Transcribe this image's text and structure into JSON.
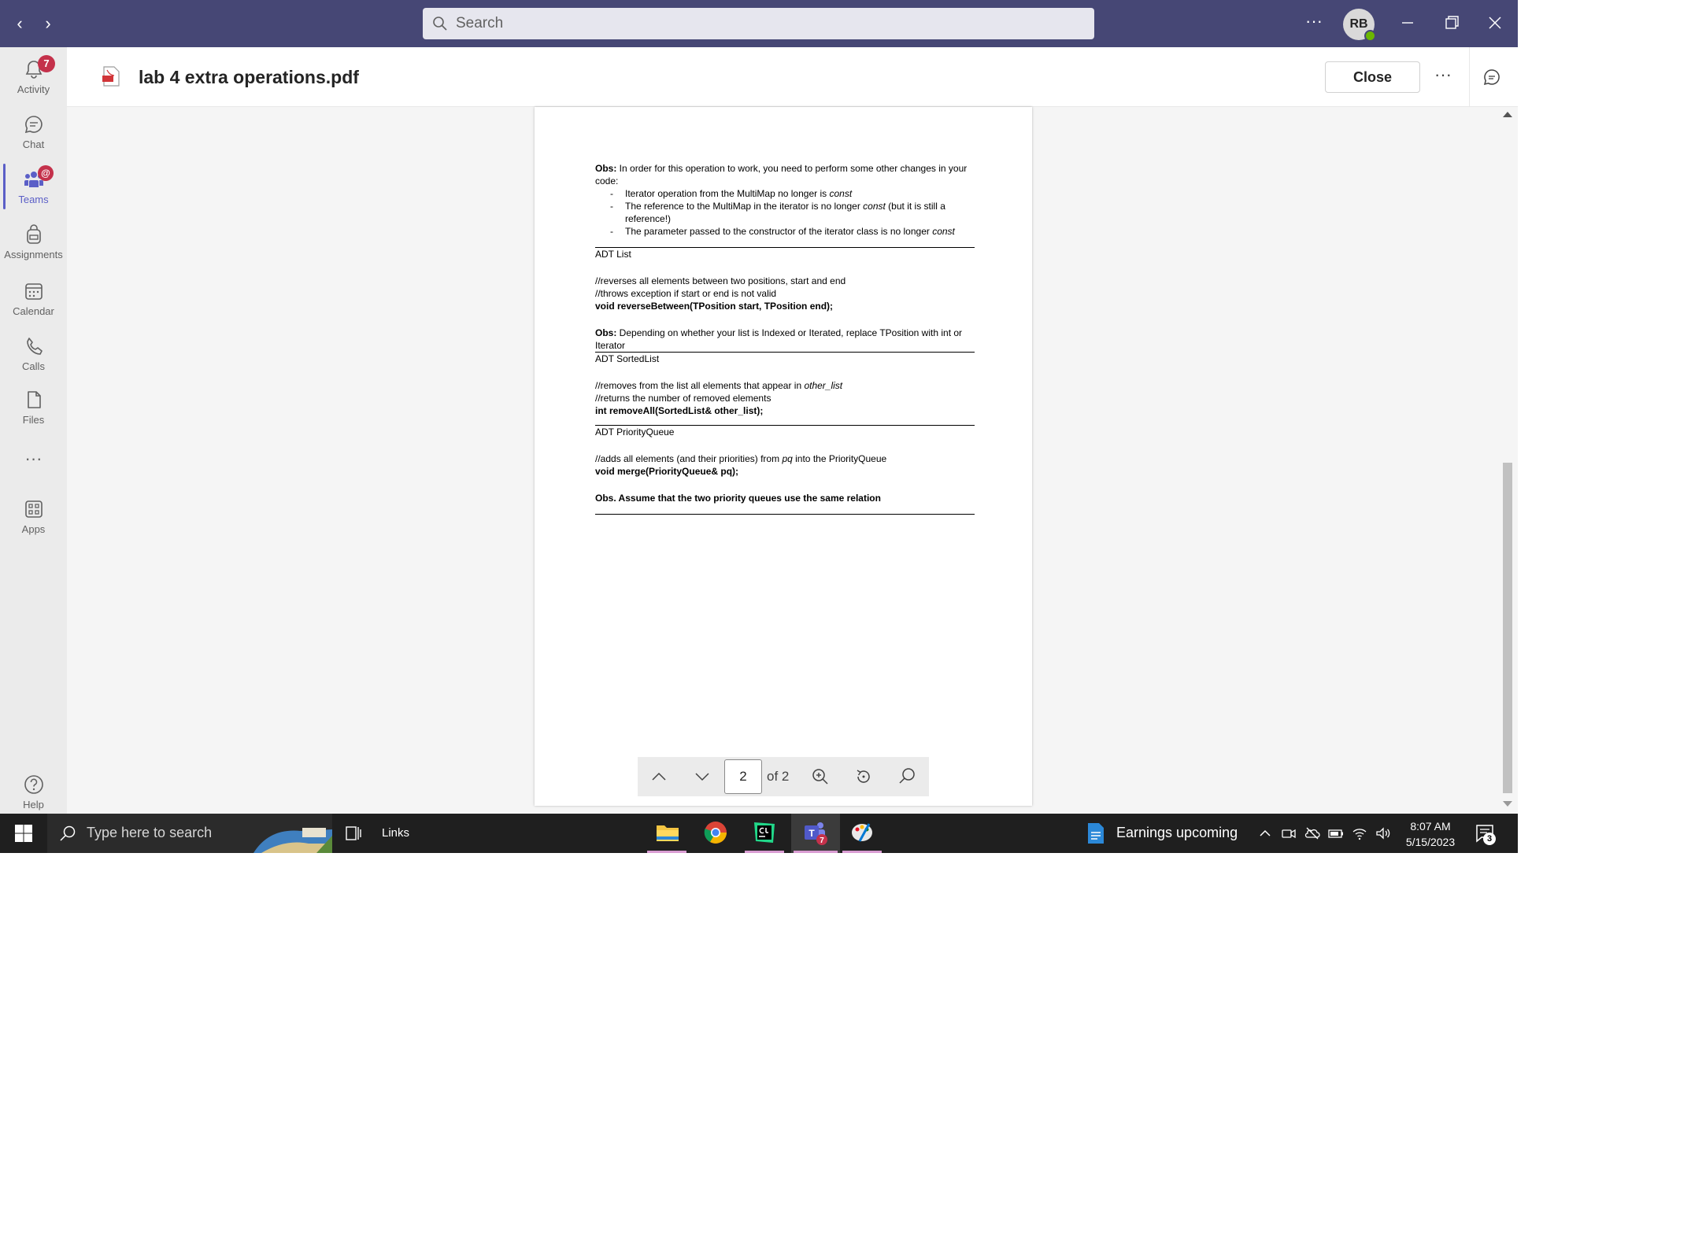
{
  "topbar": {
    "search_placeholder": "Search",
    "avatar_initials": "RB"
  },
  "rail": {
    "items": [
      {
        "label": "Activity",
        "icon": "bell-icon",
        "badge": "7"
      },
      {
        "label": "Chat",
        "icon": "chat-icon"
      },
      {
        "label": "Teams",
        "icon": "teams-icon",
        "badge": "@"
      },
      {
        "label": "Assignments",
        "icon": "backpack-icon"
      },
      {
        "label": "Calendar",
        "icon": "calendar-icon"
      },
      {
        "label": "Calls",
        "icon": "phone-icon"
      },
      {
        "label": "Files",
        "icon": "file-icon"
      },
      {
        "label": "Apps",
        "icon": "apps-icon"
      },
      {
        "label": "Help",
        "icon": "help-icon"
      }
    ],
    "more": "···"
  },
  "file": {
    "title": "lab 4 extra operations.pdf",
    "close_label": "Close",
    "more": "···"
  },
  "document": {
    "obs1_bold": "Obs:",
    "obs1_text": " In order for this operation to work, you need to perform some other changes in your code:",
    "bullet1_text": "Iterator operation from the MultiMap no longer is ",
    "bullet1_italic": "const",
    "bullet2_text": "The reference to the  MultiMap in the iterator is no longer ",
    "bullet2_italic": "const",
    "bullet2_rest": " (but it is still a reference!)",
    "bullet3_text": "The parameter passed to the constructor of the iterator class is no longer ",
    "bullet3_italic": "const",
    "list_heading": "ADT List",
    "list_comment1": "//reverses all elements between two positions, start and end",
    "list_comment2": "//throws exception if start or end is not valid",
    "list_signature": "void reverseBetween(TPosition start, TPosition end);",
    "obs2_bold": "Obs:",
    "obs2_text": " Depending on whether your list is Indexed or Iterated, replace TPosition with int or Iterator",
    "sorted_heading": "ADT SortedList",
    "sorted_comment1": "//removes from the list all elements that appear in ",
    "sorted_comment1_italic": "other_list",
    "sorted_comment2": "//returns the number of removed elements",
    "sorted_signature": "int removeAll(SortedList& other_list);",
    "pq_heading": "ADT PriorityQueue",
    "pq_comment1": "//adds all elements (and their priorities) from ",
    "pq_comment1_italic": "pq",
    "pq_comment1_rest": " into the PriorityQueue",
    "pq_signature": "void merge(PriorityQueue& pq);",
    "obs3": "Obs. Assume that the two priority queues use the same relation"
  },
  "pdf_toolbar": {
    "page_value": "2",
    "page_of": "of 2"
  },
  "taskbar": {
    "search_placeholder": "Type here to search",
    "links": "Links",
    "weather": "Earnings upcoming",
    "time": "8:07 AM",
    "date": "5/15/2023",
    "notifications": "3",
    "teams_badge": "7"
  },
  "colors": {
    "teams_purple": "#464775",
    "accent": "#5b5fc7",
    "badge_red": "#c4314b",
    "taskbar": "#1f1f1f"
  }
}
